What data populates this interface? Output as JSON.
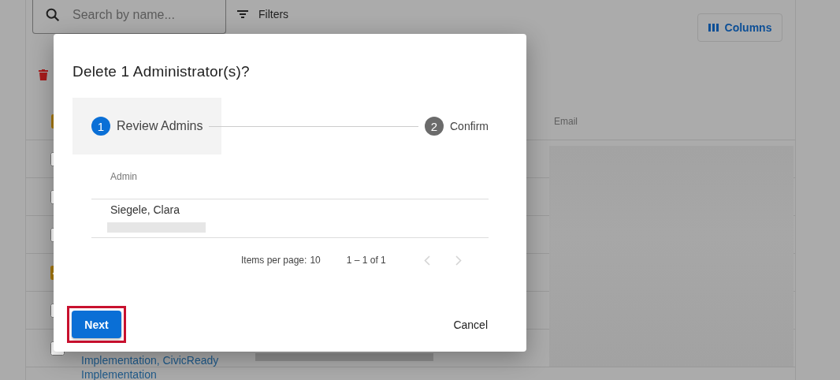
{
  "toolbar": {
    "search": {
      "placeholder": "Search by name..."
    },
    "filters_label": "Filters",
    "columns_button": "Columns"
  },
  "table": {
    "header_checkbox": {
      "indeterminate": true
    },
    "email_header": "Email",
    "rows": [
      {
        "checked": false
      },
      {
        "checked": false
      },
      {
        "checked": false
      },
      {
        "checked": true
      },
      {
        "checked": false
      },
      {
        "checked": false,
        "link": "Implementation, CivicReady Implementation"
      }
    ]
  },
  "dialog": {
    "title": "Delete 1 Administrator(s)?",
    "steps": [
      {
        "number": "1",
        "label": "Review Admins",
        "selected": true
      },
      {
        "number": "2",
        "label": "Confirm",
        "selected": false
      }
    ],
    "column": "Admin",
    "rows": [
      {
        "name": "Siegele, Clara"
      }
    ],
    "paginator": {
      "items_label": "Items per page:",
      "items_value": "10",
      "range": "1 – 1 of 1",
      "prev_disabled": true,
      "next_disabled": true
    },
    "next_button": {
      "label": "Next",
      "highlighted": true
    },
    "cancel_button": "Cancel"
  }
}
